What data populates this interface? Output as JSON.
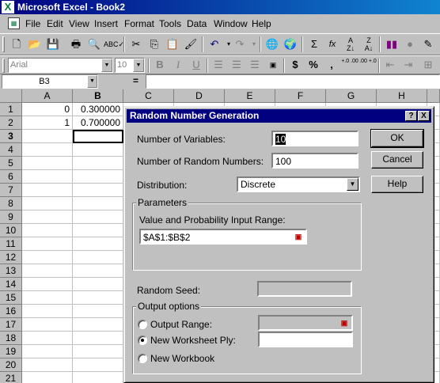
{
  "app": {
    "title": "Microsoft Excel - Book2",
    "icon": "excel-icon"
  },
  "menu": [
    "File",
    "Edit",
    "View",
    "Insert",
    "Format",
    "Tools",
    "Data",
    "Window",
    "Help"
  ],
  "format_toolbar": {
    "font": "Arial",
    "size": "10",
    "bold": "B",
    "italic": "I",
    "underline": "U",
    "currency": "$",
    "percent": "%",
    "comma": ",",
    "inc_decimal": "+.0 .00",
    "dec_decimal": ".00 +.0"
  },
  "formula_bar": {
    "name_box": "B3",
    "equals": "="
  },
  "sheet": {
    "columns": [
      "A",
      "B",
      "C",
      "D",
      "E",
      "F",
      "G",
      "H"
    ],
    "rows": [
      "1",
      "2",
      "3",
      "4",
      "5",
      "6",
      "7",
      "8",
      "9",
      "10",
      "11",
      "12",
      "13",
      "14",
      "15",
      "16",
      "17",
      "18",
      "19",
      "20",
      "21"
    ],
    "cells": {
      "A1": "0",
      "B1": "0.300000",
      "A2": "1",
      "B2": "0.700000"
    },
    "active_cell": "B3"
  },
  "dialog": {
    "title": "Random Number Generation",
    "help_caption": "?",
    "close_caption": "X",
    "num_variables_label": "Number of Variables:",
    "num_variables_value": "10",
    "num_random_label": "Number of Random Numbers:",
    "num_random_value": "100",
    "distribution_label": "Distribution:",
    "distribution_value": "Discrete",
    "parameters_title": "Parameters",
    "value_prob_label": "Value and Probability Input Range:",
    "value_prob_value": "$A$1:$B$2",
    "random_seed_label": "Random Seed:",
    "output_title": "Output options",
    "output_range_label": "Output Range:",
    "new_ply_label": "New Worksheet Ply:",
    "new_workbook_label": "New Workbook",
    "ok": "OK",
    "cancel": "Cancel",
    "help": "Help",
    "selected_output": "new_worksheet_ply"
  }
}
